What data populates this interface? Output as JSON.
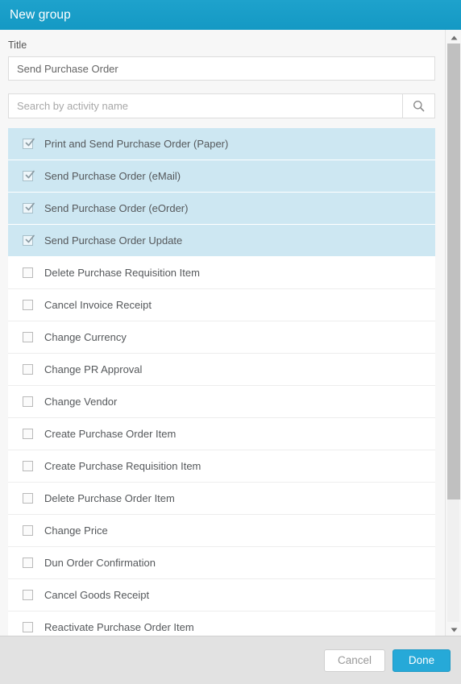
{
  "header": {
    "title": "New group",
    "background_color": "#1ba3cd"
  },
  "form": {
    "title_field": {
      "label": "Title",
      "value": "Send Purchase Order"
    },
    "search_field": {
      "value": "",
      "placeholder": "Search by activity name",
      "button_icon": "search-icon"
    }
  },
  "activity_list": {
    "items": [
      {
        "label": "Print and Send Purchase Order (Paper)",
        "checked": true
      },
      {
        "label": "Send Purchase Order (eMail)",
        "checked": true
      },
      {
        "label": "Send Purchase Order (eOrder)",
        "checked": true
      },
      {
        "label": "Send Purchase Order Update",
        "checked": true
      },
      {
        "label": "Delete Purchase Requisition Item",
        "checked": false
      },
      {
        "label": "Cancel Invoice Receipt",
        "checked": false
      },
      {
        "label": "Change Currency",
        "checked": false
      },
      {
        "label": "Change PR Approval",
        "checked": false
      },
      {
        "label": "Change Vendor",
        "checked": false
      },
      {
        "label": "Create Purchase Order Item",
        "checked": false
      },
      {
        "label": "Create Purchase Requisition Item",
        "checked": false
      },
      {
        "label": "Delete Purchase Order Item",
        "checked": false
      },
      {
        "label": "Change Price",
        "checked": false
      },
      {
        "label": "Dun Order Confirmation",
        "checked": false
      },
      {
        "label": "Cancel Goods Receipt",
        "checked": false
      },
      {
        "label": "Reactivate Purchase Order Item",
        "checked": false
      }
    ],
    "selected_color": "#cde7f2"
  },
  "scrollbar": {
    "up_icon": "triangle-up-icon",
    "down_icon": "triangle-down-icon"
  },
  "footer": {
    "cancel_label": "Cancel",
    "done_label": "Done",
    "done_color": "#26a9d8"
  }
}
